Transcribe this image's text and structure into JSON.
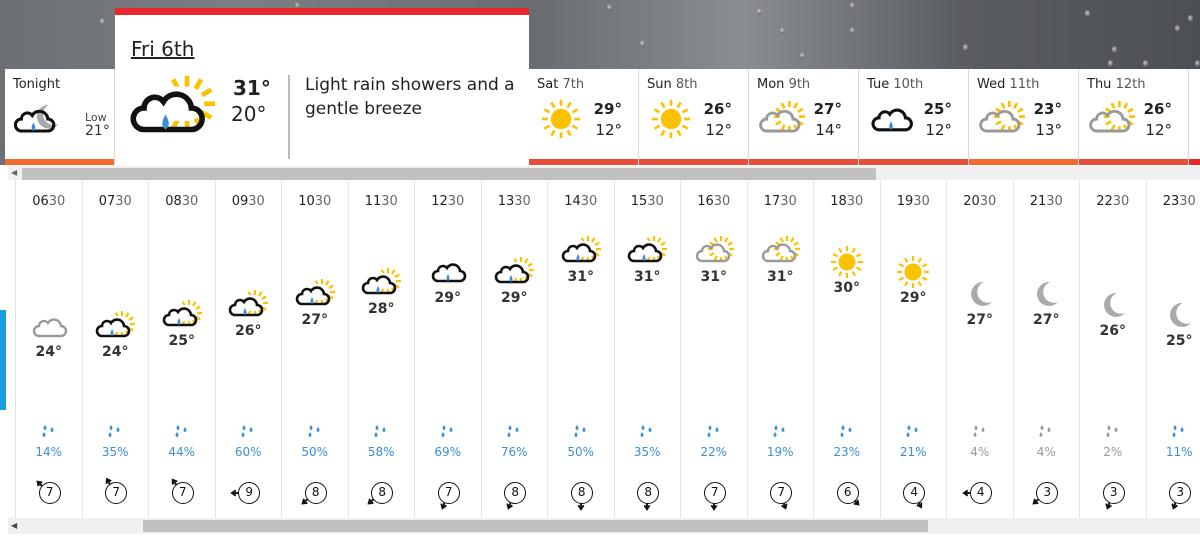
{
  "colors": {
    "selected_bar": "#e8262b",
    "red_bar": "#e94e3a",
    "orange_bar": "#f26b2e",
    "rain_blue": "#3a8fd6",
    "rain_grey": "#999999",
    "sun": "#fcc200",
    "cloud_grey": "#9a9a9a",
    "accent_blue": "#1a9ee0"
  },
  "tonight": {
    "label": "Tonight",
    "icon": "light-rain-night-icon",
    "low_label": "Low",
    "low": "21°",
    "bar": "orange"
  },
  "selected_day": {
    "title": "Fri 6th",
    "icon": "light-rain-sun-icon",
    "high": "31°",
    "low": "20°",
    "description": "Light rain showers and a gentle breeze"
  },
  "days": [
    {
      "day": "Sat",
      "date": "7th",
      "icon": "sunny-icon",
      "high": "29°",
      "low": "12°",
      "bar": "red"
    },
    {
      "day": "Sun",
      "date": "8th",
      "icon": "sunny-icon",
      "high": "26°",
      "low": "12°",
      "bar": "red"
    },
    {
      "day": "Mon",
      "date": "9th",
      "icon": "sunny-intervals-icon",
      "high": "27°",
      "low": "14°",
      "bar": "red"
    },
    {
      "day": "Tue",
      "date": "10th",
      "icon": "light-rain-icon",
      "high": "25°",
      "low": "12°",
      "bar": "red"
    },
    {
      "day": "Wed",
      "date": "11th",
      "icon": "sunny-intervals-icon",
      "high": "23°",
      "low": "13°",
      "bar": "orange"
    },
    {
      "day": "Thu",
      "date": "12th",
      "icon": "sunny-intervals-icon",
      "high": "26°",
      "low": "12°",
      "bar": "red"
    }
  ],
  "hours": [
    {
      "hh": "06",
      "mm": "30",
      "icon": "cloud",
      "temp": "24°",
      "temp_value": 24,
      "rain": "14%",
      "rain_grey": false,
      "wind": "7",
      "wind_dir": 315
    },
    {
      "hh": "07",
      "mm": "30",
      "icon": "rain-sun",
      "temp": "24°",
      "temp_value": 24,
      "rain": "35%",
      "rain_grey": false,
      "wind": "7",
      "wind_dir": 330
    },
    {
      "hh": "08",
      "mm": "30",
      "icon": "rain-sun",
      "temp": "25°",
      "temp_value": 25,
      "rain": "44%",
      "rain_grey": false,
      "wind": "7",
      "wind_dir": 325
    },
    {
      "hh": "09",
      "mm": "30",
      "icon": "rain-sun",
      "temp": "26°",
      "temp_value": 26,
      "rain": "60%",
      "rain_grey": false,
      "wind": "9",
      "wind_dir": 270
    },
    {
      "hh": "10",
      "mm": "30",
      "icon": "rain-sun",
      "temp": "27°",
      "temp_value": 27,
      "rain": "50%",
      "rain_grey": false,
      "wind": "8",
      "wind_dir": 230
    },
    {
      "hh": "11",
      "mm": "30",
      "icon": "rain-sun",
      "temp": "28°",
      "temp_value": 28,
      "rain": "58%",
      "rain_grey": false,
      "wind": "8",
      "wind_dir": 230
    },
    {
      "hh": "12",
      "mm": "30",
      "icon": "rain",
      "temp": "29°",
      "temp_value": 29,
      "rain": "69%",
      "rain_grey": false,
      "wind": "7",
      "wind_dir": 200
    },
    {
      "hh": "13",
      "mm": "30",
      "icon": "rain-sun",
      "temp": "29°",
      "temp_value": 29,
      "rain": "76%",
      "rain_grey": false,
      "wind": "8",
      "wind_dir": 200
    },
    {
      "hh": "14",
      "mm": "30",
      "icon": "rain-sun",
      "temp": "31°",
      "temp_value": 31,
      "rain": "50%",
      "rain_grey": false,
      "wind": "8",
      "wind_dir": 180
    },
    {
      "hh": "15",
      "mm": "30",
      "icon": "rain-sun",
      "temp": "31°",
      "temp_value": 31,
      "rain": "35%",
      "rain_grey": false,
      "wind": "8",
      "wind_dir": 180
    },
    {
      "hh": "16",
      "mm": "30",
      "icon": "cloud-sun",
      "temp": "31°",
      "temp_value": 31,
      "rain": "22%",
      "rain_grey": false,
      "wind": "7",
      "wind_dir": 180
    },
    {
      "hh": "17",
      "mm": "30",
      "icon": "cloud-sun",
      "temp": "31°",
      "temp_value": 31,
      "rain": "19%",
      "rain_grey": false,
      "wind": "7",
      "wind_dir": 160
    },
    {
      "hh": "18",
      "mm": "30",
      "icon": "sun",
      "temp": "30°",
      "temp_value": 30,
      "rain": "23%",
      "rain_grey": false,
      "wind": "6",
      "wind_dir": 135
    },
    {
      "hh": "19",
      "mm": "30",
      "icon": "sun",
      "temp": "29°",
      "temp_value": 29,
      "rain": "21%",
      "rain_grey": false,
      "wind": "4",
      "wind_dir": 150
    },
    {
      "hh": "20",
      "mm": "30",
      "icon": "moon",
      "temp": "27°",
      "temp_value": 27,
      "rain": "4%",
      "rain_grey": true,
      "wind": "4",
      "wind_dir": 270
    },
    {
      "hh": "21",
      "mm": "30",
      "icon": "moon",
      "temp": "27°",
      "temp_value": 27,
      "rain": "4%",
      "rain_grey": true,
      "wind": "3",
      "wind_dir": 230
    },
    {
      "hh": "22",
      "mm": "30",
      "icon": "moon",
      "temp": "26°",
      "temp_value": 26,
      "rain": "2%",
      "rain_grey": true,
      "wind": "3",
      "wind_dir": 200
    },
    {
      "hh": "23",
      "mm": "30",
      "icon": "moon",
      "temp": "25°",
      "temp_value": 25,
      "rain": "11%",
      "rain_grey": false,
      "wind": "3",
      "wind_dir": 200
    }
  ],
  "scrollbars": {
    "top_arrow": "◀",
    "bottom_arrow": "◀"
  }
}
